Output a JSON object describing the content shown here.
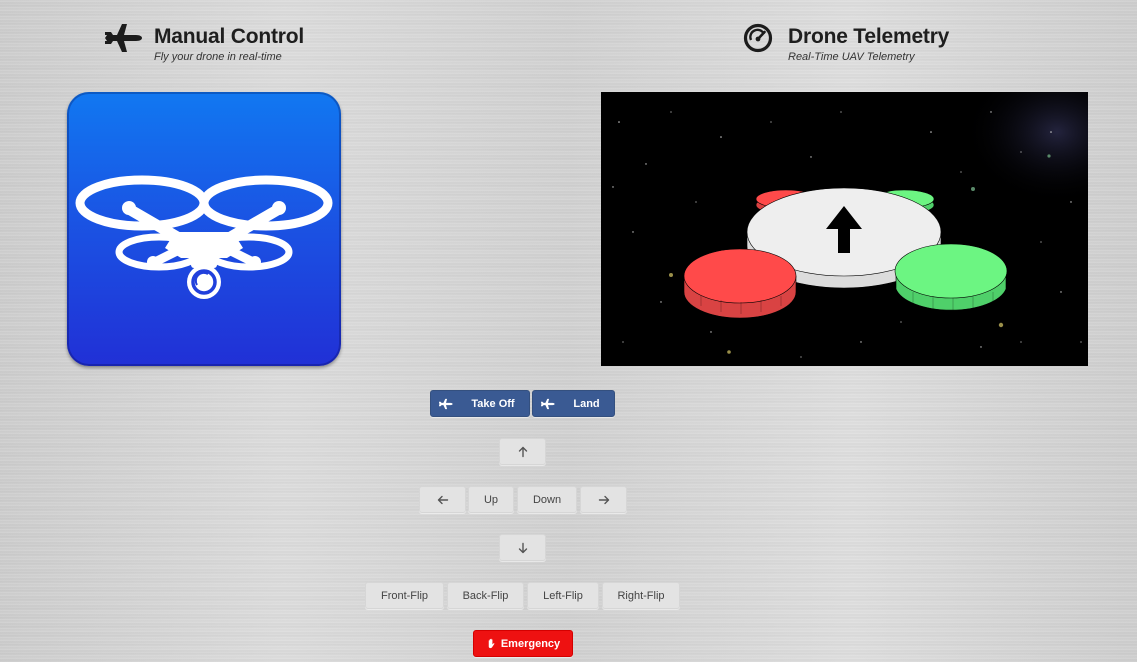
{
  "manual": {
    "title": "Manual Control",
    "subtitle": "Fly your drone in real-time",
    "icon": "airplane-icon"
  },
  "telemetry": {
    "title": "Drone Telemetry",
    "subtitle": "Real-Time UAV Telemetry",
    "icon": "gauge-icon"
  },
  "logo": {
    "icon": "drone-camera-icon",
    "color_top": "#1178f1",
    "color_bottom": "#2130d6"
  },
  "controls": {
    "takeoff_label": "Take Off",
    "land_label": "Land",
    "up_label": "Up",
    "down_label": "Down",
    "front_flip_label": "Front-Flip",
    "back_flip_label": "Back-Flip",
    "left_flip_label": "Left-Flip",
    "right_flip_label": "Right-Flip",
    "emergency_label": "Emergency"
  },
  "colors": {
    "action_blue": "#3a5a93",
    "emergency_red": "#ee1111",
    "rotor_red": "#ff4a4a",
    "rotor_green": "#6cf582"
  }
}
